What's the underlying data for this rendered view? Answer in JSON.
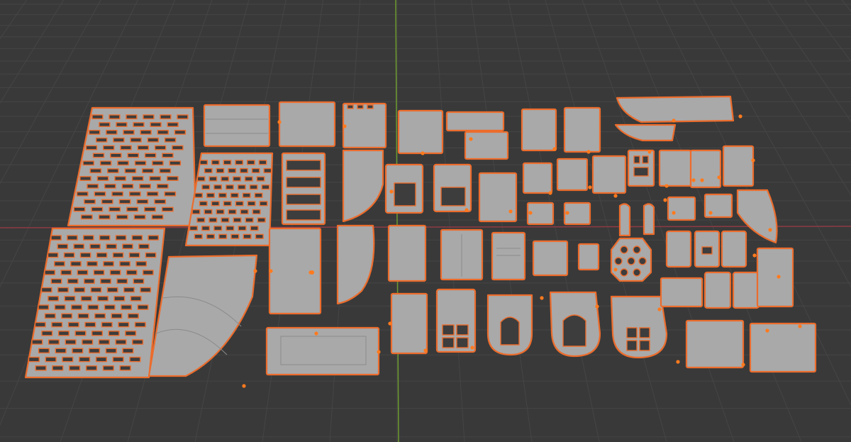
{
  "viewport": {
    "background_color": "#393939",
    "grid_color": "#454545",
    "x_axis_color": "#8e3a44",
    "y_axis_color": "#6c9a2e"
  },
  "selection": {
    "outline_color": "#ec6c2c",
    "origin_color": "#ff7a1e",
    "mesh_color": "#a9a9a9",
    "state": "all-selected"
  }
}
